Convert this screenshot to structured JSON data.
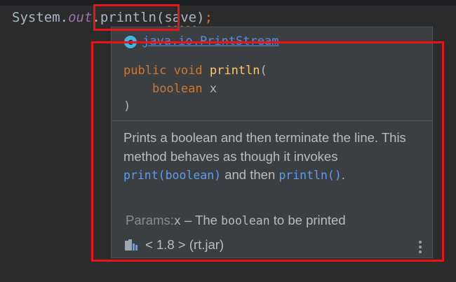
{
  "editor": {
    "code": {
      "prefix": "System.",
      "out": "out",
      "method": ".println(",
      "arg": "save",
      "close": ")",
      "semicolon": ";"
    }
  },
  "popup": {
    "class_icon": "class-icon",
    "class_icon_letter": "c",
    "class_name": "java.io.PrintStream",
    "signature": {
      "line1_kw1": "public",
      "line1_kw2": "void",
      "line1_method": "println",
      "line1_paren": "(",
      "line2_type": "boolean",
      "line2_param": "x",
      "line3": ")"
    },
    "description": {
      "text1": "Prints a boolean and then terminate the line. This method behaves as though it invokes ",
      "link1": "print(boolean)",
      "text2": " and then ",
      "link2": "println()",
      "text3": "."
    },
    "params": {
      "label": "Params:",
      "name": "x",
      "dash": " – The ",
      "type": "boolean",
      "rest": " to be printed"
    },
    "library": {
      "icon": "library-jar-icon",
      "text": "< 1.8 > (rt.jar)"
    },
    "more_icon": "more-vertical-icon"
  },
  "colors": {
    "background": "#2b2b2b",
    "popup_bg": "#3c3f41",
    "keyword": "#cc7832",
    "method": "#ffc66d",
    "link": "#589df6",
    "highlight": "#e8141a"
  }
}
